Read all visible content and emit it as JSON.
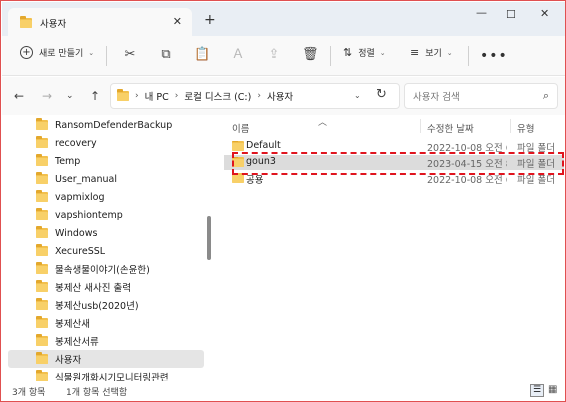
{
  "tab": {
    "title": "사용자",
    "close": "✕",
    "new_tab": "+"
  },
  "window_controls": {
    "minimize": "—",
    "maximize": "☐",
    "close": "✕"
  },
  "commandbar": {
    "new_label": "새로 만들기",
    "new_chevron": "⌄",
    "cut": "✂",
    "copy": "⧉",
    "paste": "📋",
    "rename": "Ａ",
    "share": "⇪",
    "delete": "🗑",
    "sort_label": "정렬",
    "view_label": "보기",
    "more": "•••"
  },
  "nav": {
    "back": "←",
    "forward": "→",
    "recent": "⌄",
    "up": "↑",
    "refresh": "↻"
  },
  "address": {
    "crumbs": [
      "내 PC",
      "로컬 디스크 (C:)",
      "사용자"
    ],
    "sep": "›",
    "chevron": "⌄"
  },
  "search": {
    "placeholder": "사용자 검색",
    "icon": "⌕"
  },
  "tree": {
    "items": [
      {
        "label": "RansomDefenderBackup"
      },
      {
        "label": "recovery"
      },
      {
        "label": "Temp"
      },
      {
        "label": "User_manual"
      },
      {
        "label": "vapmixlog"
      },
      {
        "label": "vapshiontemp"
      },
      {
        "label": "Windows"
      },
      {
        "label": "XecureSSL"
      },
      {
        "label": "물속생물이야기(손윤한)"
      },
      {
        "label": "봉제산 새사진 출력"
      },
      {
        "label": "봉제산usb(2020년)"
      },
      {
        "label": "봉제산새"
      },
      {
        "label": "봉제산서류"
      },
      {
        "label": "사용자",
        "selected": true
      },
      {
        "label": "식물원개화시기모니터링관련"
      }
    ]
  },
  "columns": {
    "name": "이름",
    "date": "수정한 날짜",
    "type": "유형",
    "sort_caret": "︿"
  },
  "files": [
    {
      "name": "Default",
      "date": "2022-10-08 오전 6...",
      "type": "파일 폴더"
    },
    {
      "name": "goun3",
      "date": "2023-04-15 오전 8...",
      "type": "파일 폴더",
      "selected": true
    },
    {
      "name": "공용",
      "date": "2022-10-08 오전 6...",
      "type": "파일 폴더"
    }
  ],
  "status": {
    "count": "3개 항목",
    "selected": "1개 항목 선택함"
  },
  "view_icons": {
    "details": "☰",
    "tiles": "▦"
  },
  "colors": {
    "highlight": "#e0141e",
    "folder": "#f2c04c",
    "selection": "#dcdcdc"
  }
}
